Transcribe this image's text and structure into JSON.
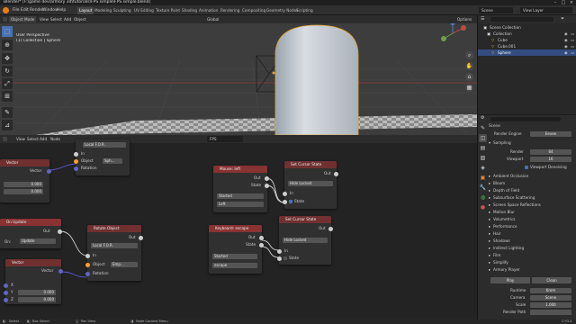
{
  "titlebar": {
    "title": "Blender* [F:\\game dev\\armory 3d\\tutorials\\FPS simple\\FPS simple.blend]",
    "controls": [
      "–",
      "□",
      "×"
    ]
  },
  "menubar": {
    "menus": [
      "File",
      "Edit",
      "Render",
      "Window",
      "Help"
    ],
    "workspaces": [
      "Layout",
      "Modeling",
      "Sculpting",
      "UV Editing",
      "Texture Paint",
      "Shading",
      "Animation",
      "Rendering",
      "Compositing",
      "Geometry Nodes",
      "Scripting"
    ],
    "active_workspace": "Layout",
    "scene": "Scene",
    "view_layer": "View Layer"
  },
  "viewport": {
    "header": {
      "mode": "Object Mode",
      "menus": [
        "View",
        "Select",
        "Add",
        "Object"
      ],
      "orientation": "Global",
      "options": "Options"
    },
    "overlay_text": [
      "User Perspective",
      "(1) Collection | Sphere"
    ]
  },
  "outliner": {
    "title": "Scene Collection",
    "items": [
      {
        "name": "Scene Collection",
        "selected": false
      },
      {
        "name": "Collection",
        "selected": false
      },
      {
        "name": "Cube",
        "selected": false
      },
      {
        "name": "Cube.001",
        "selected": false
      },
      {
        "name": "Sphere",
        "selected": true
      }
    ]
  },
  "properties": {
    "search_placeholder": "",
    "scene_name": "Scene",
    "render_engine_label": "Render Engine",
    "render_engine": "Eevee",
    "sampling": {
      "title": "Sampling",
      "render_label": "Render",
      "render_value": "64",
      "viewport_label": "Viewport",
      "viewport_value": "16",
      "denoise_label": "Viewport Denoising"
    },
    "panels": [
      "Ambient Occlusion",
      "Bloom",
      "Depth of Field",
      "Subsurface Scattering",
      "Screen Space Reflections",
      "Motion Blur",
      "Volumetrics",
      "Performance",
      "Hair",
      "Shadows",
      "Indirect Lighting",
      "Film",
      "Simplify",
      "Armory Player"
    ],
    "player": {
      "play_label": "Play",
      "clean_label": "Clean",
      "runtime_label": "Runtime",
      "runtime_value": "Krom",
      "camera_label": "Camera",
      "camera_value": "Scene",
      "scale_label": "Scale",
      "scale_value": "1.000",
      "render_path_label": "Render Path"
    }
  },
  "node_editor": {
    "header": {
      "menus": [
        "View",
        "Select",
        "Add",
        "Node"
      ],
      "tree_name": "FPS"
    },
    "nodes": {
      "transform_partial": {
        "space_value": "Local F.O.R.",
        "in_label": "In",
        "object_label": "Object",
        "object_value": "Sph...",
        "rotation_label": "Rotation"
      },
      "vector_top": {
        "title": "Vector",
        "out_label": "Vector",
        "x_label": "X",
        "x_value": "0.000",
        "z_label": "Z",
        "z_value": "0.000"
      },
      "on_update": {
        "title": "On Update",
        "out_label": "Out",
        "on_label": "On:",
        "on_value": "Update"
      },
      "rotate_object": {
        "title": "Rotate Object",
        "out_label": "Out",
        "space_value": "Local F.O.R.",
        "in_label": "In",
        "object_label": "Object",
        "object_value": "Emp...",
        "rotation_label": "Rotation"
      },
      "vector_bottom": {
        "title": "Vector",
        "out_label": "Vector",
        "x_label": "X",
        "y_label": "Y",
        "y_value": "0.000",
        "z_label": "Z",
        "z_value": "0.000"
      },
      "mouse_left": {
        "title": "Mouse: left",
        "out_label": "Out",
        "state_label": "State",
        "event_value": "Started",
        "button_value": "Left"
      },
      "set_cursor_1": {
        "title": "Set Cursor State",
        "out_label": "Out",
        "mode_value": "Hide Locked",
        "in_label": "In",
        "state_label": "State"
      },
      "keyboard_escape": {
        "title": "Keyboard: escape",
        "out_label": "Out",
        "state_label": "State",
        "event_value": "Started",
        "key_value": "escape"
      },
      "set_cursor_2": {
        "title": "Set Cursor State",
        "out_label": "Out",
        "mode_value": "Hide Locked",
        "in_label": "In",
        "state_label": "State"
      }
    }
  },
  "statusbar": {
    "items": [
      "Select",
      "Box Select",
      "Pan View",
      "Node Context Menu"
    ],
    "version": "2.93.4"
  },
  "colors": {
    "node_header_red": "#883232",
    "selection_blue": "#4772b3",
    "socket_object": "#ff9d2e",
    "socket_vector": "#6363c7",
    "viewport_bg": "#3d3d3d",
    "node_editor_bg": "#232323"
  }
}
